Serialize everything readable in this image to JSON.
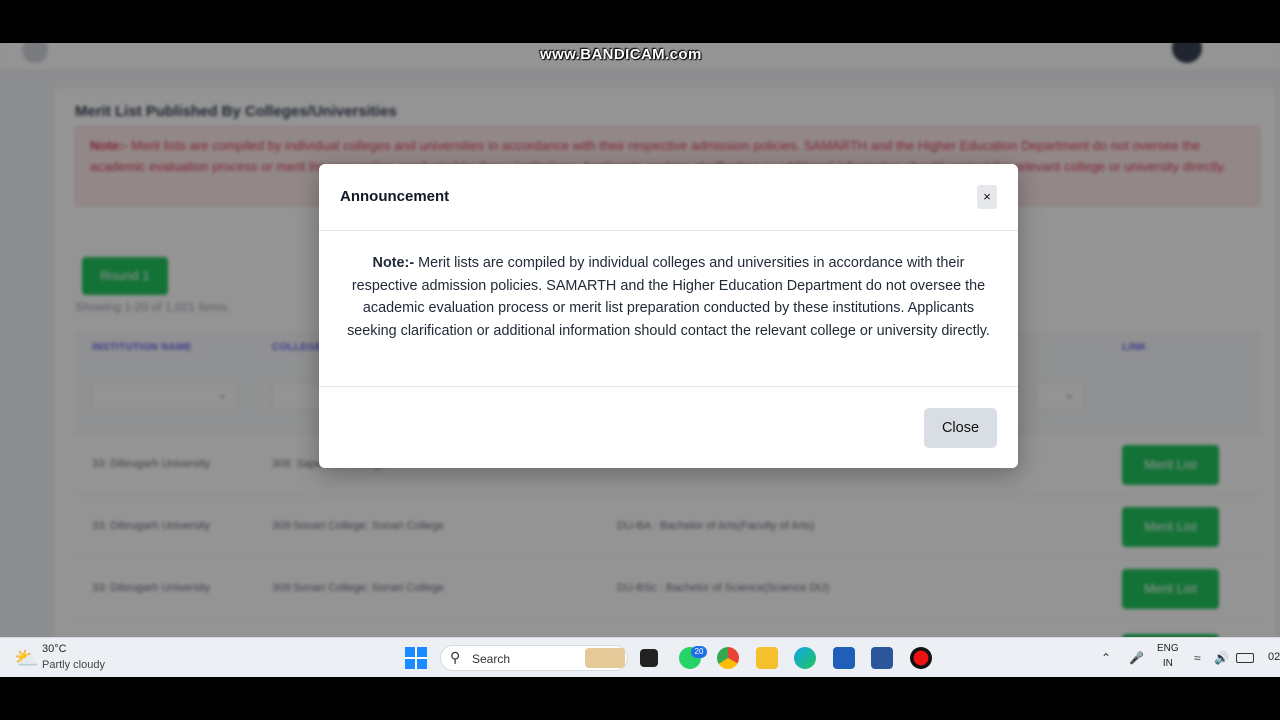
{
  "watermark": "www.BANDICAM.com",
  "background_page": {
    "card_title": "Merit List Published By Colleges/Universities",
    "note_label": "Note:-",
    "note_text": "Merit lists are compiled by individual colleges and universities in accordance with their respective admission policies. SAMARTH and the Higher Education Department do not oversee the academic evaluation process or merit list preparation conducted by these institutions. Applicants seeking clarification or additional information should contact the relevant college or university directly.",
    "round_button": "Round 1",
    "summary": "Showing 1-20 of 1,021 items.",
    "columns": [
      "INSTITUTION NAME",
      "COLLEGE",
      "LINK"
    ],
    "rows": [
      {
        "institution": "33: Dibrugarh University",
        "college": "308: Sapekhati College",
        "course": "",
        "link": "Merit List"
      },
      {
        "institution": "33: Dibrugarh University",
        "college": "309:Sonari College: Sonari College",
        "course": "DU-BA : Bachelor of Arts(Faculty of Arts)",
        "link": "Merit List"
      },
      {
        "institution": "33: Dibrugarh University",
        "college": "309:Sonari College: Sonari College",
        "course": "DU-BSc : Bachelor of Science(Science DU)",
        "link": "Merit List"
      }
    ]
  },
  "modal": {
    "title": "Announcement",
    "close_x": "×",
    "note_label": "Note:-",
    "note_text": " Merit lists are compiled by individual colleges and universities in accordance with their respective admission policies. SAMARTH and the Higher Education Department do not oversee the academic evaluation process or merit list preparation conducted by these institutions. Applicants seeking clarification or additional information should contact the relevant college or university directly.",
    "close_button": "Close"
  },
  "taskbar": {
    "weather_temp": "30°C",
    "weather_desc": "Partly cloudy",
    "search_placeholder": "Search",
    "whatsapp_badge": "20",
    "lang_line1": "ENG",
    "lang_line2": "IN",
    "clock": "02"
  }
}
